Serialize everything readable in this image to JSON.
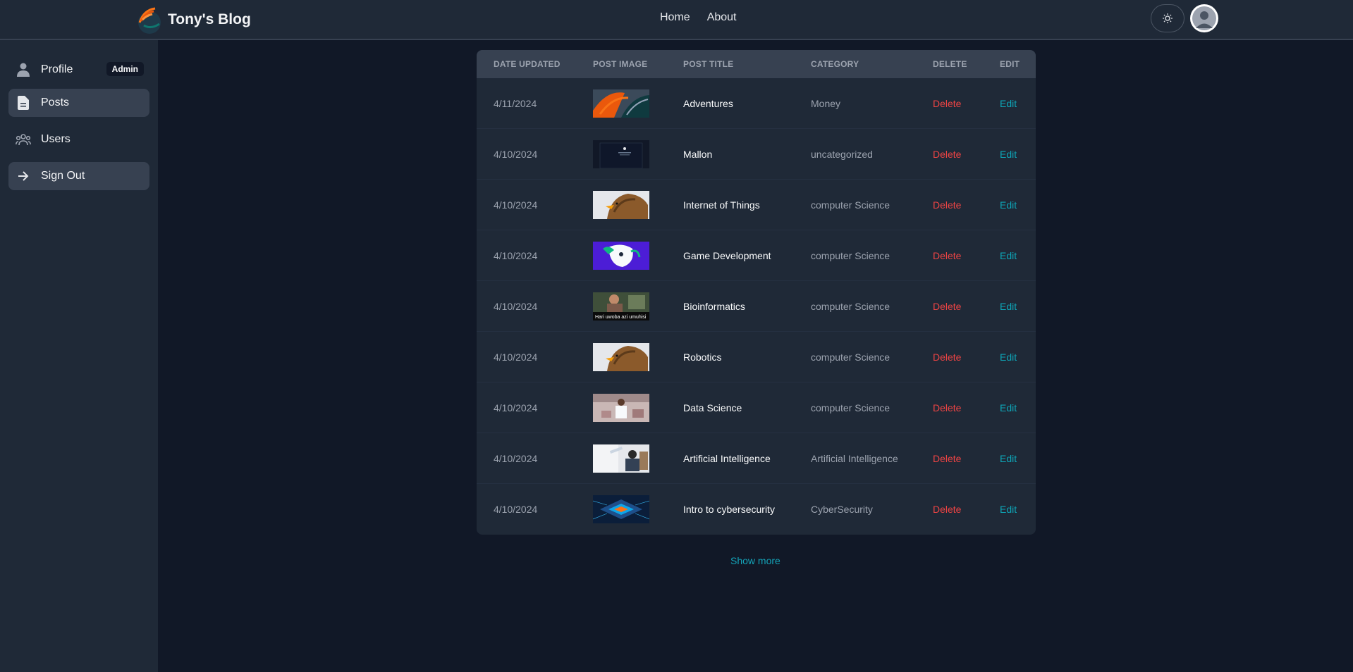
{
  "header": {
    "brand_title": "Tony's Blog",
    "nav": [
      "Home",
      "About"
    ],
    "theme_icon": "sun-icon",
    "avatar_icon": "user-avatar-icon"
  },
  "sidebar": {
    "items": [
      {
        "label": "Profile",
        "icon": "user-icon",
        "badge": "Admin"
      },
      {
        "label": "Posts",
        "icon": "document-icon"
      },
      {
        "label": "Users",
        "icon": "users-icon"
      },
      {
        "label": "Sign Out",
        "icon": "arrow-right-icon"
      }
    ]
  },
  "table": {
    "headers": [
      "Date updated",
      "Post image",
      "Post title",
      "Category",
      "Delete",
      "Edit"
    ],
    "rows": [
      {
        "date": "4/11/2024",
        "title": "Adventures",
        "category": "Money",
        "delete": "Delete",
        "edit": "Edit"
      },
      {
        "date": "4/10/2024",
        "title": "Mallon",
        "category": "uncategorized",
        "delete": "Delete",
        "edit": "Edit"
      },
      {
        "date": "4/10/2024",
        "title": "Internet of Things",
        "category": "computer Science",
        "delete": "Delete",
        "edit": "Edit"
      },
      {
        "date": "4/10/2024",
        "title": "Game Development",
        "category": "computer Science",
        "delete": "Delete",
        "edit": "Edit"
      },
      {
        "date": "4/10/2024",
        "title": "Bioinformatics",
        "category": "computer Science",
        "delete": "Delete",
        "edit": "Edit"
      },
      {
        "date": "4/10/2024",
        "title": "Robotics",
        "category": "computer Science",
        "delete": "Delete",
        "edit": "Edit"
      },
      {
        "date": "4/10/2024",
        "title": "Data Science",
        "category": "computer Science",
        "delete": "Delete",
        "edit": "Edit"
      },
      {
        "date": "4/10/2024",
        "title": "Artificial Intelligence",
        "category": "Artificial Intelligence",
        "delete": "Delete",
        "edit": "Edit"
      },
      {
        "date": "4/10/2024",
        "title": "Intro to cybersecurity",
        "category": "CyberSecurity",
        "delete": "Delete",
        "edit": "Edit"
      }
    ],
    "thumb_text_bioinformatics": "Hari uwoba azi umuhisi"
  },
  "show_more": "Show more",
  "colors": {
    "background": "#111827",
    "panel": "#1f2937",
    "header_row": "#374151",
    "delete": "#ef4444",
    "edit": "#0ea5b7"
  }
}
